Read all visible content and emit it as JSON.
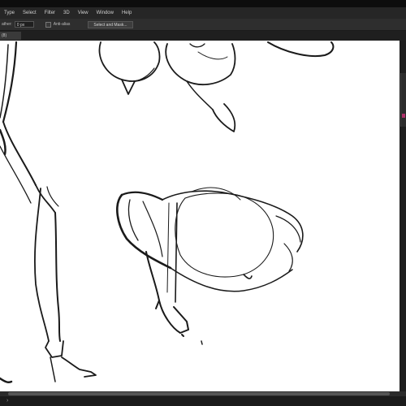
{
  "menu": {
    "items": [
      "Type",
      "Select",
      "Filter",
      "3D",
      "View",
      "Window",
      "Help"
    ]
  },
  "options": {
    "feather_label": "ather:",
    "feather_value": "0 px",
    "antialias_label": "Anti-alias",
    "select_mask_label": "Select and Mask..."
  },
  "document": {
    "tab_label": "(8)"
  },
  "colors": {
    "canvas": "#ffffff",
    "chrome_dark": "#262626",
    "accent_panel": "#b0306a"
  }
}
